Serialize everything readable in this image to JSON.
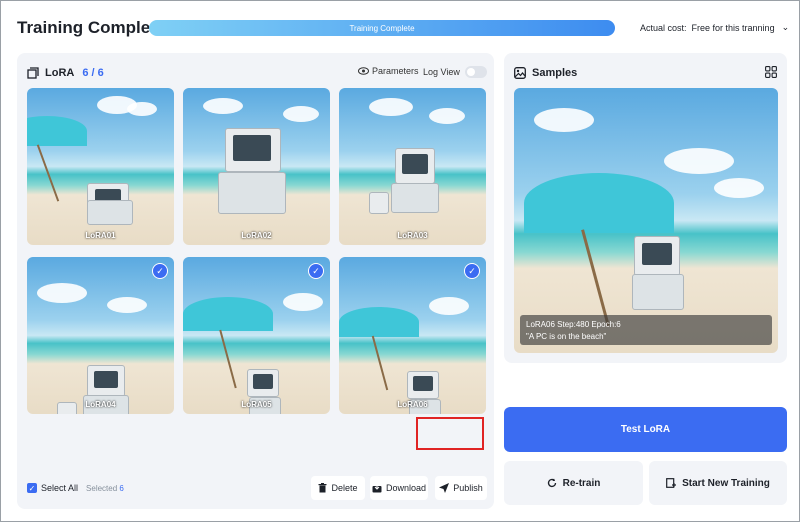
{
  "header": {
    "title": "Training Complete",
    "progress_text": "Training Complete",
    "cost_label": "Actual cost:",
    "cost_value": "Free for this tranning"
  },
  "lora": {
    "label": "LoRA",
    "count": "6 / 6",
    "parameters": "Parameters",
    "log_view": "Log View",
    "thumbs": [
      {
        "label": "LoRA01",
        "checked": false
      },
      {
        "label": "LoRA02",
        "checked": false
      },
      {
        "label": "LoRA03",
        "checked": false
      },
      {
        "label": "LoRA04",
        "checked": true
      },
      {
        "label": "LoRA05",
        "checked": true
      },
      {
        "label": "LoRA06",
        "checked": true
      }
    ],
    "select_all": "Select All",
    "selected_label": "Selected",
    "selected_count": "6",
    "delete": "Delete",
    "download": "Download",
    "publish": "Publish"
  },
  "samples": {
    "title": "Samples",
    "caption_line1": "LoRA06 Step:480 Epoch:6",
    "caption_line2": "\"A PC is on the beach\""
  },
  "actions": {
    "test": "Test LoRA",
    "retrain": "Re-train",
    "new_training": "Start New Training"
  },
  "colors": {
    "accent": "#3b6cf2",
    "highlight": "#e02424"
  }
}
